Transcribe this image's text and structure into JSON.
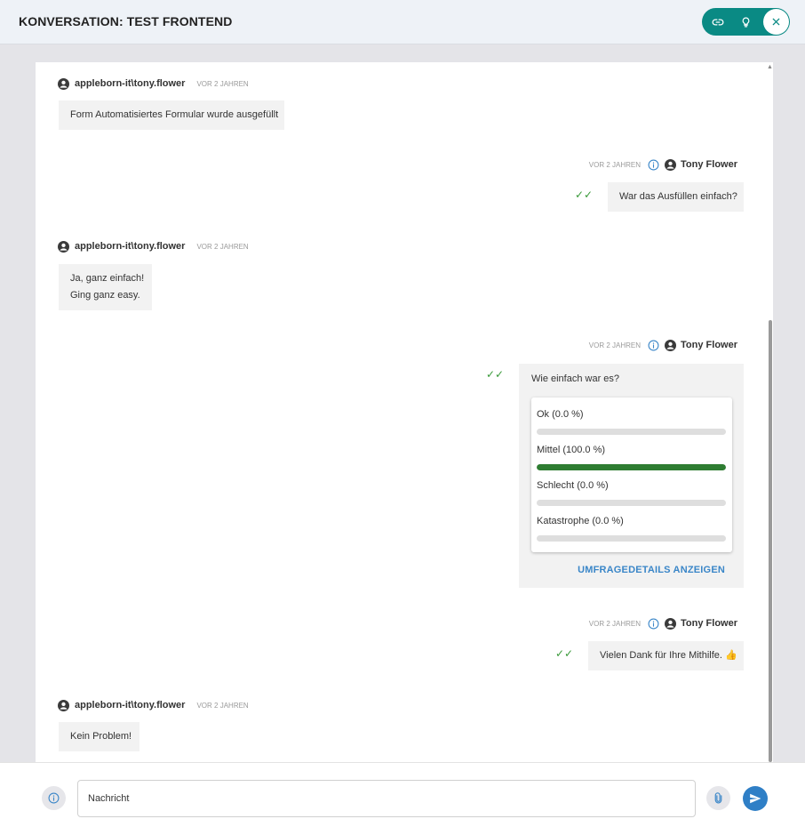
{
  "header": {
    "title": "KONVERSATION: TEST FRONTEND",
    "link_icon": "link-icon",
    "lightbulb_icon": "lightbulb-icon",
    "close_icon": "close-icon",
    "accent_color": "#0a8a84"
  },
  "messages": [
    {
      "side": "left",
      "author": "appleborn-it\\tony.flower",
      "time": "VOR 2 JAHREN",
      "lines": [
        "Form Automatisiertes Formular wurde ausgefüllt"
      ]
    },
    {
      "side": "right",
      "author": "Tony Flower",
      "time": "VOR 2 JAHREN",
      "lines": [
        "War das Ausfüllen einfach?"
      ],
      "read_receipt_icon": "double-check-icon"
    },
    {
      "side": "left",
      "author": "appleborn-it\\tony.flower",
      "time": "VOR 2 JAHREN",
      "lines": [
        "Ja, ganz einfach!",
        "Ging ganz easy."
      ]
    },
    {
      "side": "right",
      "author": "Tony Flower",
      "time": "VOR 2 JAHREN",
      "type": "poll",
      "read_receipt_icon": "double-check-icon"
    },
    {
      "side": "right",
      "author": "Tony Flower",
      "time": "VOR 2 JAHREN",
      "lines": [
        "Vielen Dank für Ihre Mithilfe. 👍"
      ],
      "read_receipt_icon": "double-check-icon"
    },
    {
      "side": "left",
      "author": "appleborn-it\\tony.flower",
      "time": "VOR 2 JAHREN",
      "lines": [
        "Kein Problem!"
      ]
    }
  ],
  "poll": {
    "question": "Wie einfach war es?",
    "options": [
      {
        "label": "Ok (0.0 %)",
        "fraction": 0.0
      },
      {
        "label": "Mittel (100.0 %)",
        "fraction": 1.0
      },
      {
        "label": "Schlecht (0.0 %)",
        "fraction": 0.0
      },
      {
        "label": "Katastrophe (0.0 %)",
        "fraction": 0.0
      }
    ],
    "details_label": "UMFRAGEDETAILS ANZEIGEN",
    "bar_color": "#2e7d32",
    "link_color": "#3a86c8"
  },
  "input": {
    "placeholder": "Nachricht",
    "info_icon": "info-icon",
    "attach_icon": "paperclip-icon",
    "send_icon": "send-icon",
    "send_color": "#2f7fc6"
  }
}
